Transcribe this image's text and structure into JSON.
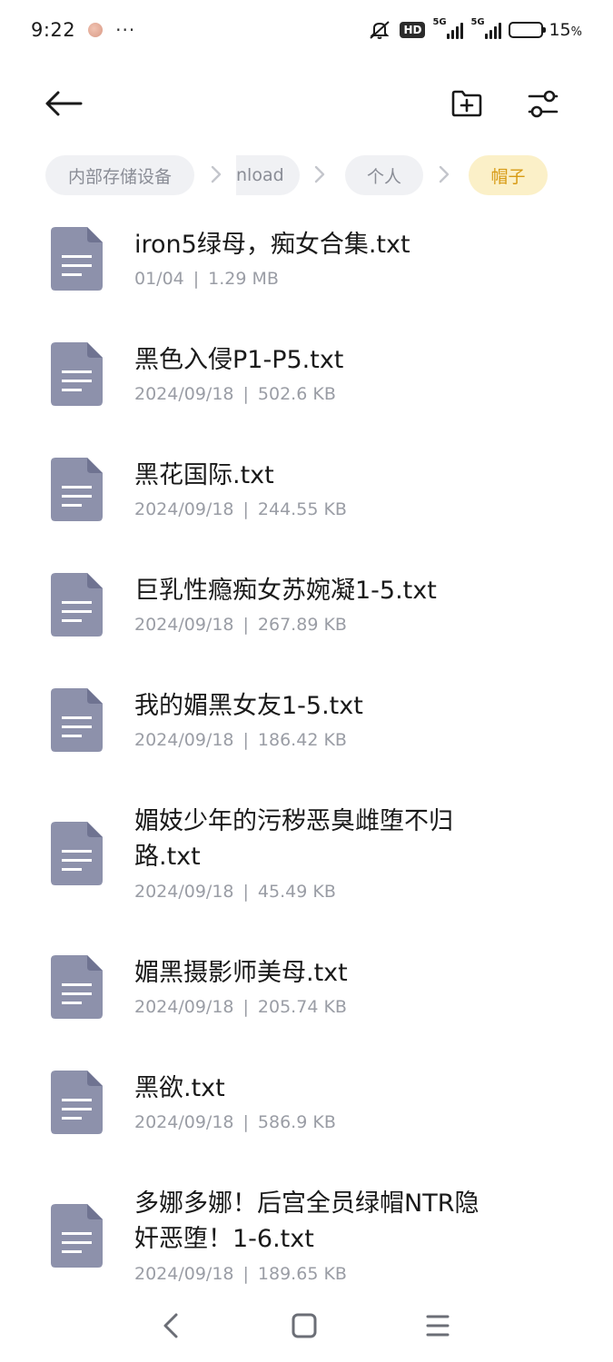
{
  "status_bar": {
    "time": "9:22",
    "more": "···",
    "hd_label": "HD",
    "sim1_label": "5G",
    "sim2_label": "5G",
    "battery_percent": 15,
    "battery_text": "15",
    "battery_unit": "%"
  },
  "toolbar": {
    "back_icon": "arrow-left-icon",
    "new_folder_icon": "folder-plus-icon",
    "filter_icon": "sliders-icon"
  },
  "breadcrumb": {
    "items": [
      "内部存储设备",
      "nload",
      "个人",
      "帽子"
    ],
    "active_index": 3
  },
  "files": [
    {
      "name": "iron5绿母，痴女合集.txt",
      "date": "01/04",
      "size": "1.29 MB"
    },
    {
      "name": "黑色入侵P1-P5.txt",
      "date": "2024/09/18",
      "size": "502.6 KB"
    },
    {
      "name": "黑花国际.txt",
      "date": "2024/09/18",
      "size": "244.55 KB"
    },
    {
      "name": "巨乳性瘾痴女苏婉凝1-5.txt",
      "date": "2024/09/18",
      "size": "267.89 KB"
    },
    {
      "name": "我的媚黑女友1-5.txt",
      "date": "2024/09/18",
      "size": "186.42 KB"
    },
    {
      "name": "媚妓少年的污秽恶臭雌堕不归路.txt",
      "date": "2024/09/18",
      "size": "45.49 KB"
    },
    {
      "name": "媚黑摄影师美母.txt",
      "date": "2024/09/18",
      "size": "205.74 KB"
    },
    {
      "name": "黑欲.txt",
      "date": "2024/09/18",
      "size": "586.9 KB"
    },
    {
      "name": "多娜多娜！后宫全员绿帽NTR隐奸恶堕！1-6.txt",
      "date": "2024/09/18",
      "size": "189.65 KB"
    }
  ],
  "meta_separator": "|",
  "colors": {
    "file_icon": "#8d91ab",
    "file_icon_fold": "#6f7391",
    "active_crumb_bg": "#fbf0c8",
    "active_crumb_text": "#d79a13",
    "battery": "#f2b705"
  },
  "nav": {
    "back_icon": "nav-back-icon",
    "home_icon": "nav-home-icon",
    "recents_icon": "nav-recents-icon"
  }
}
